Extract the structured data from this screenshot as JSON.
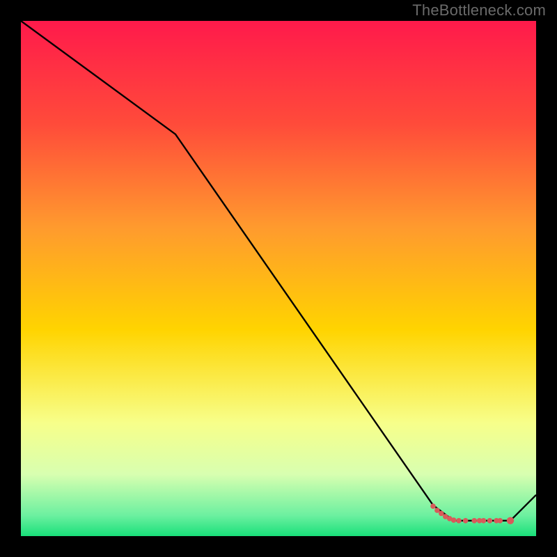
{
  "watermark": "TheBottleneck.com",
  "colors": {
    "background": "#000000",
    "top": "#ff1a4b",
    "mid": "#ffd400",
    "bottom": "#19e07a",
    "line": "#000000",
    "accent": "#d85a5a"
  },
  "chart_data": {
    "type": "line",
    "title": "",
    "xlabel": "",
    "ylabel": "",
    "xlim": [
      0,
      100
    ],
    "ylim": [
      0,
      100
    ],
    "grid": false,
    "legend": false,
    "gradient_stops": [
      {
        "offset": 0.0,
        "color": "#ff1a4b"
      },
      {
        "offset": 0.2,
        "color": "#ff4b3a"
      },
      {
        "offset": 0.4,
        "color": "#ff9a2e"
      },
      {
        "offset": 0.6,
        "color": "#ffd400"
      },
      {
        "offset": 0.78,
        "color": "#f7ff8a"
      },
      {
        "offset": 0.88,
        "color": "#d8ffb0"
      },
      {
        "offset": 0.96,
        "color": "#6cf0a0"
      },
      {
        "offset": 1.0,
        "color": "#19e07a"
      }
    ],
    "series": [
      {
        "name": "bottleneck-curve",
        "x": [
          0,
          30,
          80,
          84,
          95,
          100
        ],
        "values": [
          100,
          78,
          6,
          3,
          3,
          8
        ]
      }
    ],
    "markers": [
      {
        "x": 80.0,
        "y": 5.8
      },
      {
        "x": 80.8,
        "y": 5.0
      },
      {
        "x": 81.6,
        "y": 4.4
      },
      {
        "x": 82.4,
        "y": 3.8
      },
      {
        "x": 83.2,
        "y": 3.4
      },
      {
        "x": 84.0,
        "y": 3.1
      },
      {
        "x": 85.0,
        "y": 3.0
      },
      {
        "x": 86.3,
        "y": 3.0
      },
      {
        "x": 88.0,
        "y": 3.0
      },
      {
        "x": 89.0,
        "y": 3.0
      },
      {
        "x": 89.8,
        "y": 3.0
      },
      {
        "x": 91.0,
        "y": 3.0
      },
      {
        "x": 92.3,
        "y": 3.0
      },
      {
        "x": 93.0,
        "y": 3.0
      },
      {
        "x": 95.0,
        "y": 3.0
      }
    ]
  }
}
